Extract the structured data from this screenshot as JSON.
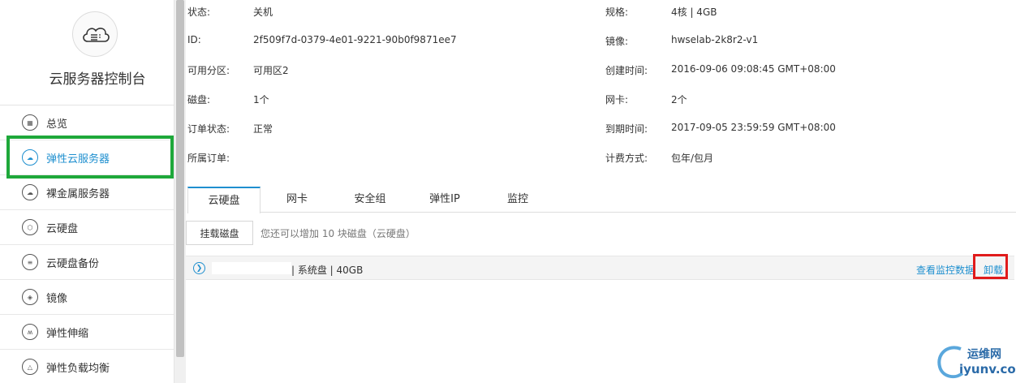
{
  "sidebar": {
    "title": "云服务器控制台",
    "items": [
      {
        "label": "总览",
        "icon": "grid-icon"
      },
      {
        "label": "弹性云服务器",
        "icon": "cloud-icon",
        "active": true
      },
      {
        "label": "裸金属服务器",
        "icon": "server-cloud-icon"
      },
      {
        "label": "云硬盘",
        "icon": "cube-icon"
      },
      {
        "label": "云硬盘备份",
        "icon": "disk-backup-icon"
      },
      {
        "label": "镜像",
        "icon": "layers-icon"
      },
      {
        "label": "弹性伸缩",
        "icon": "autoscale-icon"
      },
      {
        "label": "弹性负载均衡",
        "icon": "balance-icon"
      }
    ]
  },
  "details": {
    "left": [
      {
        "label": "状态:",
        "value": "关机"
      },
      {
        "label": "ID:",
        "value": "2f509f7d-0379-4e01-9221-90b0f9871ee7"
      },
      {
        "label": "可用分区:",
        "value": "可用区2"
      },
      {
        "label": "磁盘:",
        "value": "1个"
      },
      {
        "label": "订单状态:",
        "value": "正常"
      },
      {
        "label": "所属订单:",
        "value": ""
      }
    ],
    "right": [
      {
        "label": "规格:",
        "value": "4核 | 4GB"
      },
      {
        "label": "镜像:",
        "value": "hwselab-2k8r2-v1"
      },
      {
        "label": "创建时间:",
        "value": "2016-09-06 09:08:45 GMT+08:00"
      },
      {
        "label": "网卡:",
        "value": "2个"
      },
      {
        "label": "到期时间:",
        "value": "2017-09-05 23:59:59 GMT+08:00"
      },
      {
        "label": "计费方式:",
        "value": "包年/包月"
      }
    ]
  },
  "tabs": [
    "云硬盘",
    "网卡",
    "安全组",
    "弹性IP",
    "监控"
  ],
  "disk_panel": {
    "mount_button": "挂载磁盘",
    "hint": "您还可以增加 10 块磁盘（云硬盘）",
    "disk_info": "| 系统盘 | 40GB",
    "monitor_link": "查看监控数据",
    "unmount_link": "卸载"
  },
  "watermark": {
    "line1": "运维网",
    "line2": "iyunv.com"
  },
  "colors": {
    "accent": "#1e8fcf",
    "highlight_green": "#1ea83a",
    "highlight_red": "#e01b1b"
  }
}
